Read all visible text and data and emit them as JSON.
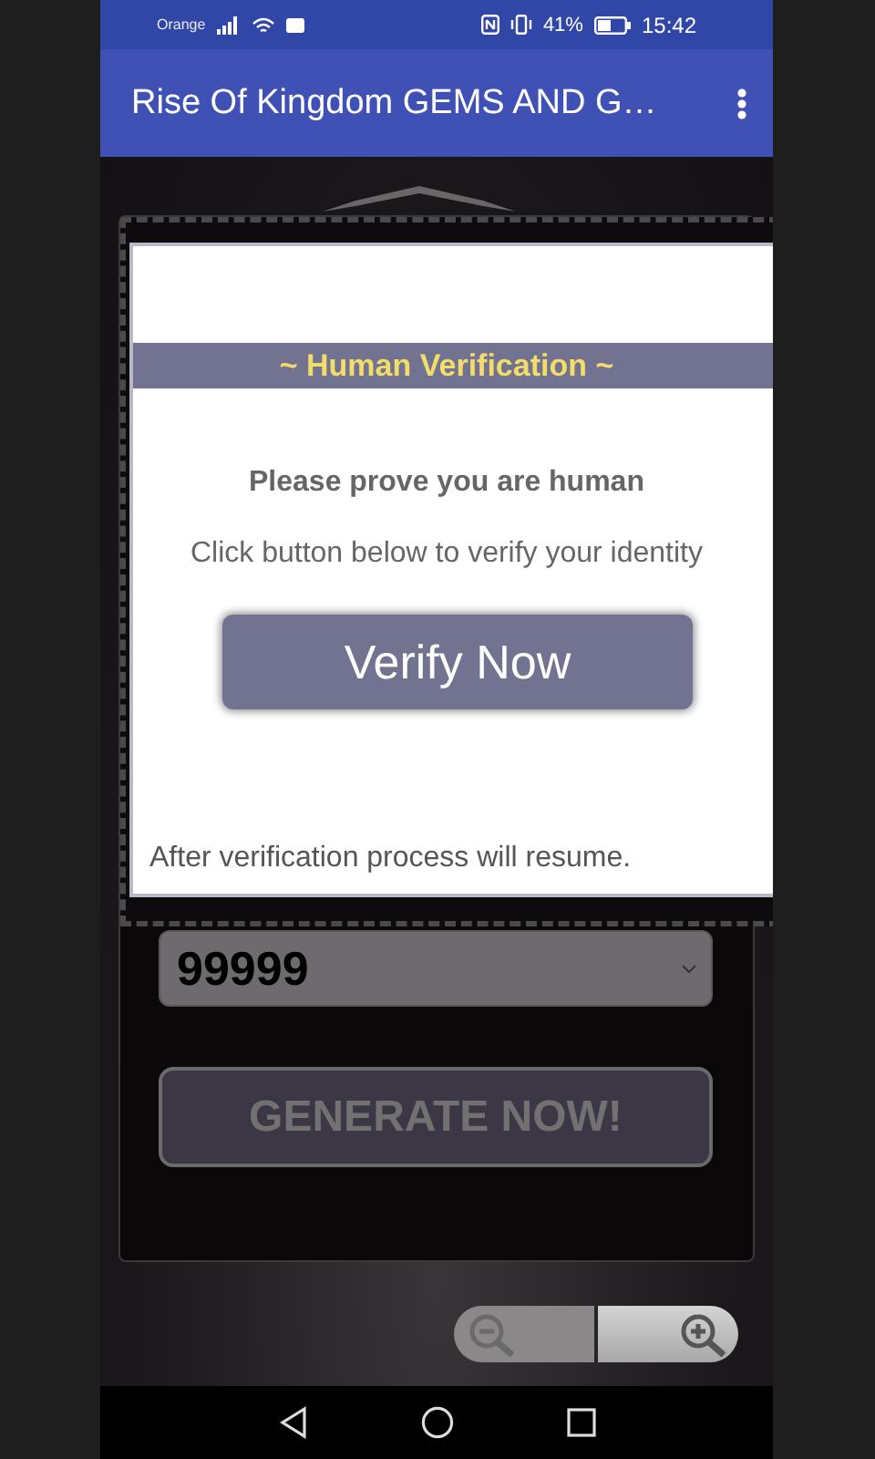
{
  "status_bar": {
    "carrier": "Orange",
    "battery": "41%",
    "time": "15:42"
  },
  "app_bar": {
    "title": "Rise Of Kingdom GEMS AND G…"
  },
  "dialog": {
    "heading": "~ Human Verification ~",
    "prompt": "Please prove you are human",
    "instruction": "Click button below to verify your identity",
    "button": "Verify Now",
    "footer": "After verification process will resume."
  },
  "form": {
    "amount": "99999",
    "generate_button": "GENERATE NOW!"
  }
}
